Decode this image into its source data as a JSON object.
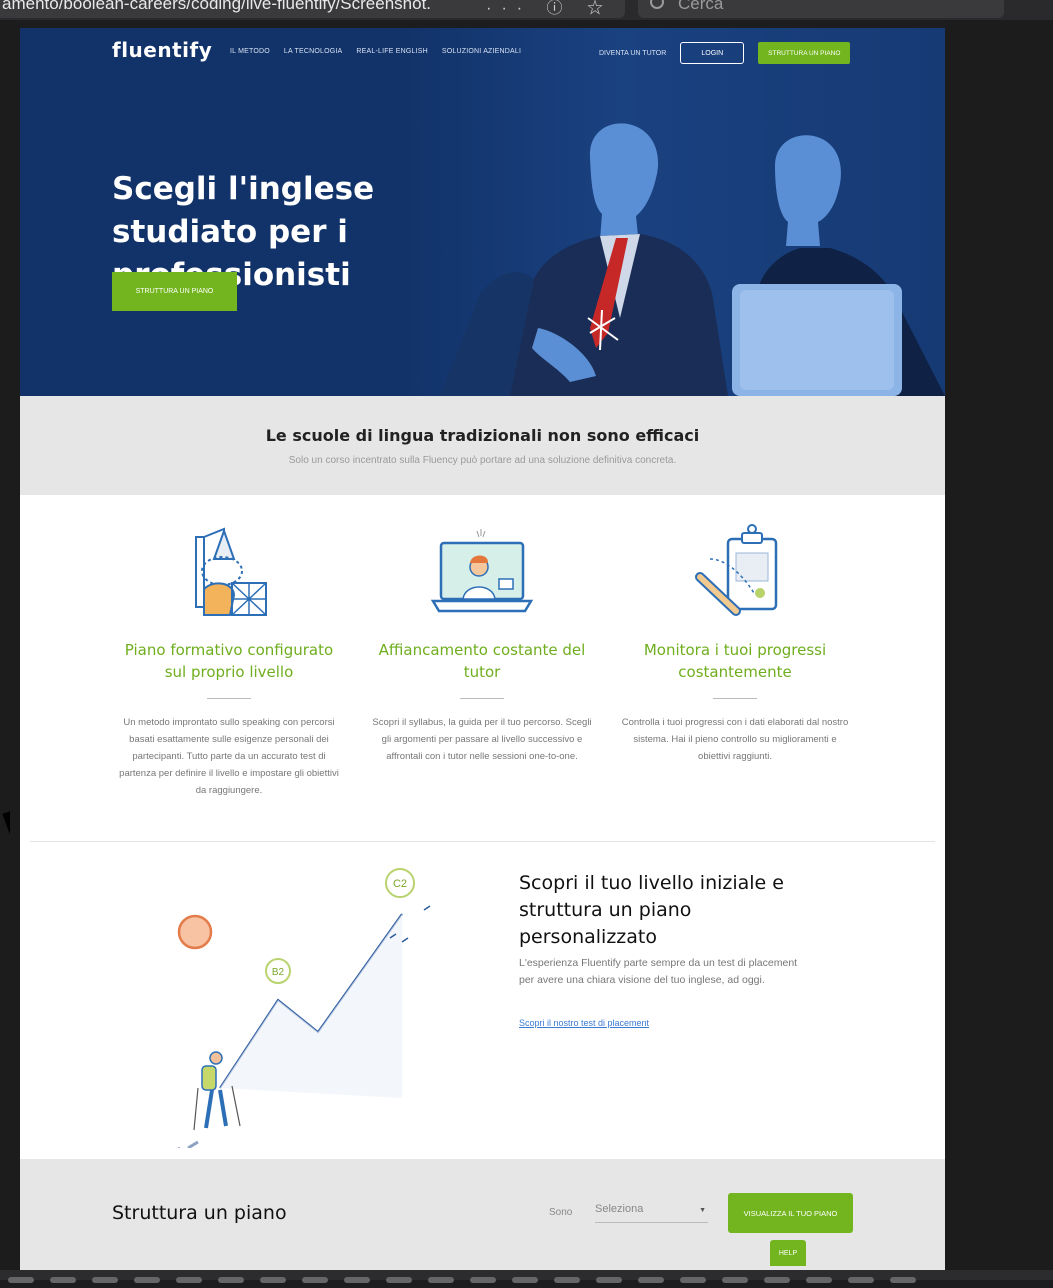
{
  "browser": {
    "url": "amento/boolean-careers/coding/live-fluentify/Screenshot.",
    "url_icons": "··· ⓘ ☆",
    "search_placeholder": "Cerca"
  },
  "header": {
    "logo": "fluentify",
    "nav": [
      "IL METODO",
      "LA TECNOLOGIA",
      "REAL-LIFE ENGLISH",
      "SOLUZIONI AZIENDALI"
    ],
    "tutor_link": "DIVENTA UN TUTOR",
    "login": "LOGIN",
    "cta": "STRUTTURA UN PIANO"
  },
  "hero": {
    "title": "Scegli l'inglese studiato per i professionisti",
    "cta": "STRUTTURA UN PIANO"
  },
  "intro": {
    "title": "Le scuole di lingua tradizionali non sono efficaci",
    "subtitle": "Solo un corso incentrato sulla Fluency può portare ad una soluzione definitiva concreta."
  },
  "features": [
    {
      "title": "Piano formativo configurato sul proprio livello",
      "text": "Un metodo improntato sullo speaking con percorsi basati esattamente sulle esigenze personali dei partecipanti. Tutto parte da un accurato test di partenza per definire il livello e impostare gli obiettivi da raggiungere."
    },
    {
      "title": "Affiancamento costante del tutor",
      "text": "Scopri il syllabus, la guida per il tuo percorso. Scegli gli argomenti per passare al livello successivo e affrontali con i tutor nelle sessioni one-to-one."
    },
    {
      "title": "Monitora i tuoi progressi costantemente",
      "text": "Controlla i tuoi progressi con i dati elaborati dal nostro sistema. Hai il pieno controllo su miglioramenti e obiettivi raggiunti."
    }
  ],
  "level": {
    "title": "Scopri il tuo livello iniziale e struttura un piano personalizzato",
    "text": "L'esperienza Fluentify parte sempre da un test di placement per avere una chiara visione del tuo inglese, ad oggi.",
    "link": "Scopri il nostro test di placement",
    "badge_low": "B2",
    "badge_high": "C2"
  },
  "plan": {
    "title": "Struttura un piano",
    "sono_label": "Sono",
    "select_value": "Seleziona",
    "view_button": "VISUALIZZA IL TUO PIANO",
    "help": "HELP"
  },
  "colors": {
    "hero_bg": "#12336a",
    "accent_green": "#73b51f",
    "feature_title_green": "#6fae1e",
    "illustration_blue": "#2d6fb7"
  }
}
